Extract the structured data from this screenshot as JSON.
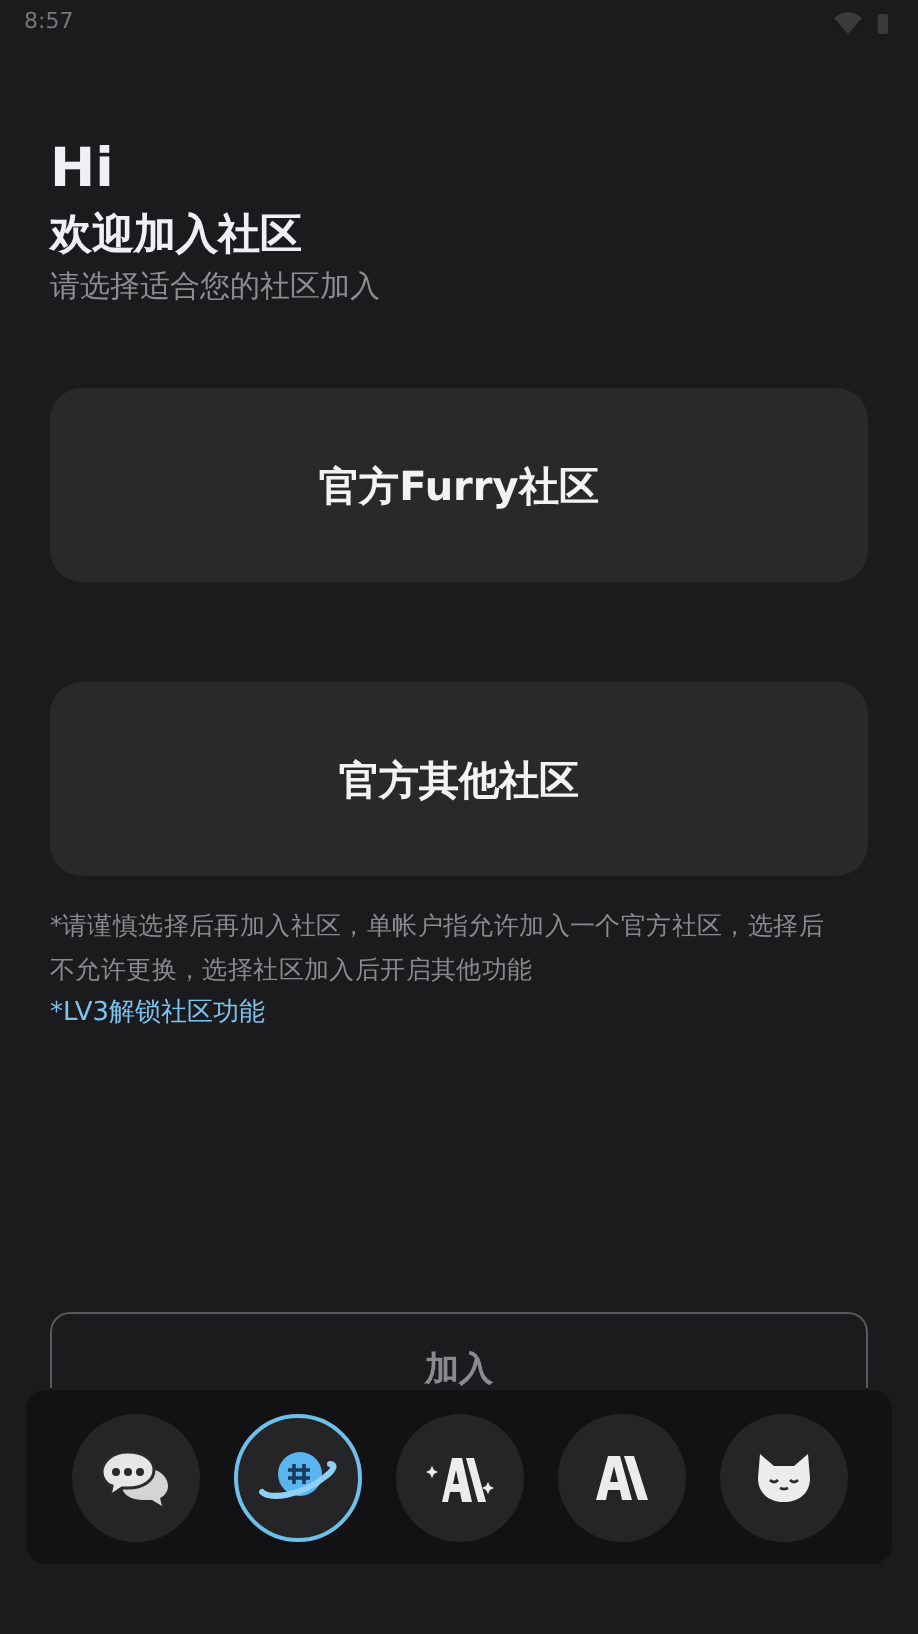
{
  "status_bar": {
    "time": "8:57"
  },
  "greeting": "Hi",
  "title": "欢迎加入社区",
  "subtitle": "请选择适合您的社区加入",
  "communities": [
    {
      "label": "官方Furry社区"
    },
    {
      "label": "官方其他社区"
    }
  ],
  "notice": "*请谨慎选择后再加入社区，单帐户指允许加入一个官方社区，选择后不允许更换，选择社区加入后开启其他功能",
  "unlock_link": "*LV3解锁社区功能",
  "join_button": "加入",
  "nav": [
    {
      "kind": "chat",
      "selected": false
    },
    {
      "kind": "planet",
      "selected": true
    },
    {
      "kind": "ai-sparkle",
      "selected": false
    },
    {
      "kind": "ai",
      "selected": false
    },
    {
      "kind": "fox",
      "selected": false
    }
  ]
}
